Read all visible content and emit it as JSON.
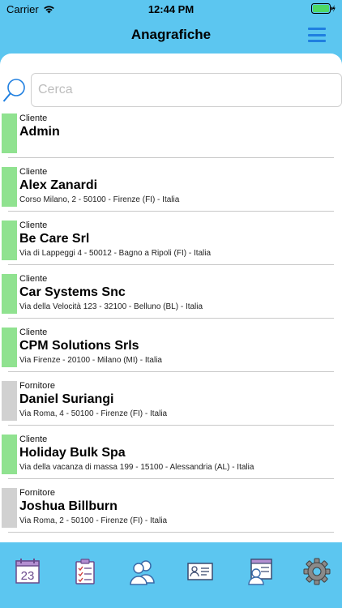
{
  "status": {
    "carrier": "Carrier",
    "time": "12:44 PM"
  },
  "nav": {
    "title": "Anagrafiche"
  },
  "search": {
    "placeholder": "Cerca",
    "value": ""
  },
  "colors": {
    "cliente": "#90e290",
    "fornitore": "#d1d1d1",
    "accent": "#1f7fe0",
    "header": "#5cc6f0"
  },
  "entries": [
    {
      "type": "Cliente",
      "name": "Admin",
      "address": "",
      "color": "#90e290"
    },
    {
      "type": "Cliente",
      "name": "Alex Zanardi",
      "address": "Corso Milano, 2 - 50100 - Firenze (FI) - Italia",
      "color": "#90e290"
    },
    {
      "type": "Cliente",
      "name": "Be Care Srl",
      "address": "Via di Lappeggi 4 - 50012 - Bagno a Ripoli (FI) - Italia",
      "color": "#90e290"
    },
    {
      "type": "Cliente",
      "name": "Car Systems Snc",
      "address": "Via della Velocità 123 - 32100 - Belluno (BL) - Italia",
      "color": "#90e290"
    },
    {
      "type": "Cliente",
      "name": "CPM Solutions Srls",
      "address": "Via Firenze - 20100 - Milano (MI) - Italia",
      "color": "#90e290"
    },
    {
      "type": "Fornitore",
      "name": "Daniel Suriangi",
      "address": "Via Roma, 4 - 50100 - Firenze (FI) - Italia",
      "color": "#d1d1d1"
    },
    {
      "type": "Cliente",
      "name": "Holiday Bulk Spa",
      "address": "Via della vacanza di massa 199 - 15100 - Alessandria (AL) - Italia",
      "color": "#90e290"
    },
    {
      "type": "Fornitore",
      "name": "Joshua Billburn",
      "address": "Via Roma, 2 - 50100 - Firenze (FI) - Italia",
      "color": "#d1d1d1"
    }
  ],
  "tabs": [
    {
      "icon": "calendar-icon",
      "day": "23"
    },
    {
      "icon": "clipboard-checklist-icon"
    },
    {
      "icon": "contacts-icon"
    },
    {
      "icon": "id-card-icon"
    },
    {
      "icon": "contact-list-icon"
    },
    {
      "icon": "gear-icon"
    }
  ]
}
